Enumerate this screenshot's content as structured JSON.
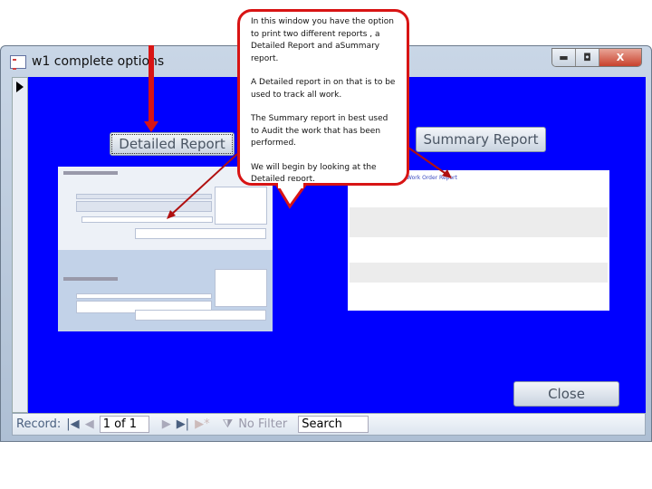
{
  "window": {
    "title": "w1 complete options",
    "minimize_label": "▬",
    "maximize_label": "◘",
    "close_label": "X"
  },
  "buttons": {
    "detailed_report": "Detailed Report",
    "summary_report": "Summary Report",
    "close": "Close"
  },
  "summary_preview": {
    "title": "Work Order Report"
  },
  "navigation": {
    "record_label": "Record:",
    "first": "|◀",
    "prev": "◀",
    "current": "1 of 1",
    "next": "▶",
    "last": "▶|",
    "new": "▶*",
    "filter_label": "No Filter",
    "search_placeholder": "Search"
  },
  "callout": {
    "paragraphs": [
      "In this window you have the option to print two different reports , a Detailed Report and aSummary report.",
      "A Detailed report in on that is to be used to track all work.",
      "The Summary report in best used to Audit the work that has been performed.",
      "We will begin by looking at the Detailed report."
    ]
  },
  "colors": {
    "form_background": "#0000ff",
    "annotation": "#d81414"
  }
}
